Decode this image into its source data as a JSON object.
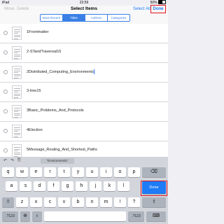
{
  "status_bar": {
    "carrier": "iPad",
    "time": "22:59",
    "battery": "50%"
  },
  "navbar": {
    "move_label": "Move",
    "delete_label": "Delete",
    "title": "Select Items",
    "select_all_label": "Select All",
    "done_label": "Done",
    "segments": [
      "Most Recent",
      "Titles",
      "Authors",
      "Categories"
    ],
    "active_segment": "Titles"
  },
  "files": [
    {
      "name": "1Frontmatter"
    },
    {
      "name": "2-STandTraversal15"
    },
    {
      "name": "2Distributed_Computing_Environments"
    },
    {
      "name": "3-tree15"
    },
    {
      "name": "3Basic_Problems_And_Protocols"
    },
    {
      "name": "4Election"
    },
    {
      "name": "5Message_Routing_And_Shortest_Paths"
    }
  ],
  "keyboard": {
    "suggestion": "“Environments”",
    "row1": [
      "q",
      "w",
      "e",
      "r",
      "t",
      "y",
      "u",
      "i",
      "o",
      "p"
    ],
    "row2": [
      "a",
      "s",
      "d",
      "f",
      "g",
      "h",
      "j",
      "k",
      "l"
    ],
    "row3": [
      "z",
      "x",
      "c",
      "v",
      "b",
      "n",
      "m",
      "!",
      "?"
    ],
    "backspace_icon": "⌫",
    "shift_icon": "⇧",
    "numbers_label": ".?123",
    "globe_icon": "⊕",
    "mic_icon": "♁",
    "dismiss_icon": "⌨",
    "done_key_label": "Done",
    "toolbar_icons": [
      "↶",
      "↷",
      "⎘"
    ]
  }
}
